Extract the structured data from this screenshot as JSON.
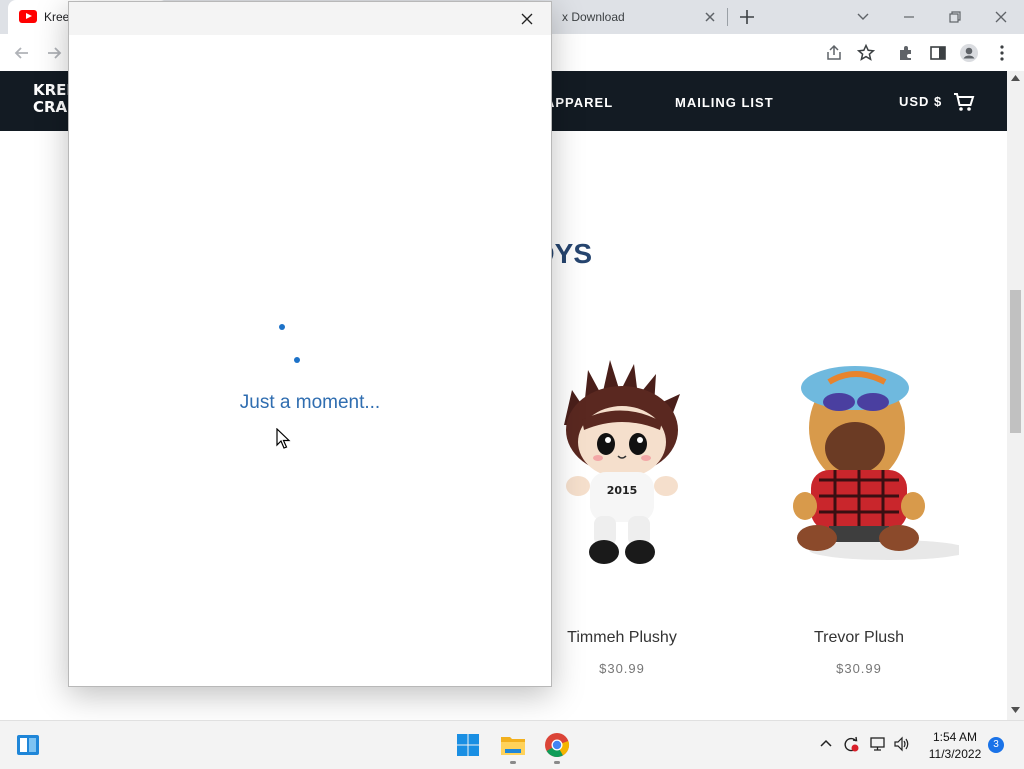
{
  "browser": {
    "tabs": [
      {
        "title": "Kree",
        "icon": "youtube-icon"
      },
      {
        "title": "x Download"
      }
    ]
  },
  "site": {
    "logo_line1": "KREE",
    "logo_line2": "CRAF",
    "nav": [
      "APPAREL",
      "MAILING LIST"
    ],
    "currency": "USD $",
    "section_heading": "DYS",
    "products": [
      {
        "name": "Timmeh Plushy",
        "price": "$30.99"
      },
      {
        "name": "Trevor Plush",
        "price": "$30.99"
      }
    ]
  },
  "popup": {
    "message": "Just a moment..."
  },
  "taskbar": {
    "time": "1:54 AM",
    "date": "11/3/2022",
    "notification_count": "3"
  },
  "colors": {
    "nav_bg": "#131b23",
    "heading": "#26456f",
    "spinner": "#1d72c8",
    "loading_text": "#2f6db0"
  }
}
